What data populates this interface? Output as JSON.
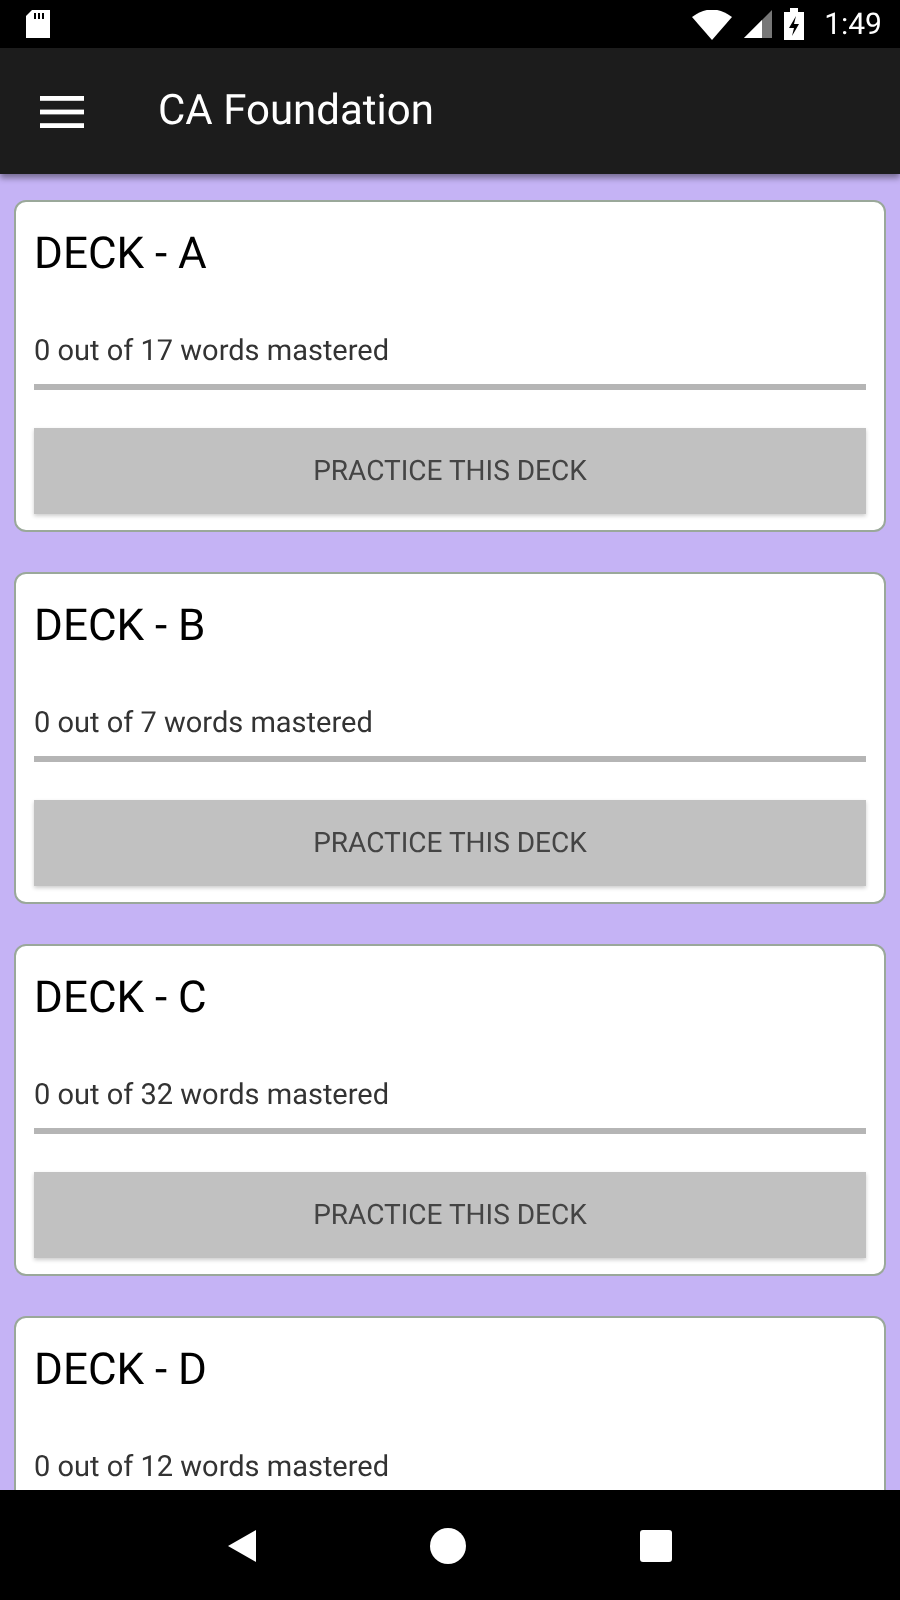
{
  "status_bar": {
    "time": "1:49"
  },
  "app_bar": {
    "title": "CA Foundation"
  },
  "decks": [
    {
      "title": "DECK - A",
      "progress_text": "0 out of 17 words mastered",
      "level": 0,
      "button": "PRACTICE THIS DECK"
    },
    {
      "title": "DECK - B",
      "progress_text": "0 out of 7 words mastered",
      "level": 0,
      "button": "PRACTICE THIS DECK"
    },
    {
      "title": "DECK - C",
      "progress_text": "0 out of 32 words mastered",
      "level": 0,
      "button": "PRACTICE THIS DECK"
    },
    {
      "title": "DECK - D",
      "progress_text": "0 out of 12 words mastered"
    }
  ]
}
